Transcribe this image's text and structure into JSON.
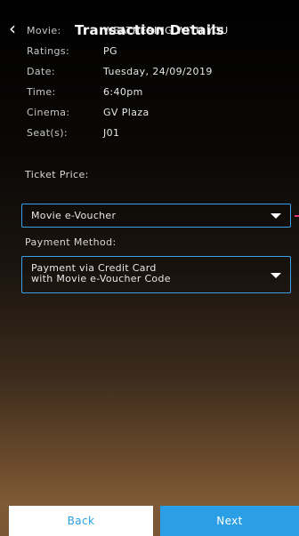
{
  "header": {
    "back_icon": "chevron-left-icon",
    "back_glyph": "‹",
    "title": "Transaction Details"
  },
  "details": [
    {
      "label": "Movie:",
      "value": "WEATHERING WITH YOU"
    },
    {
      "label": "Ratings:",
      "value": "PG"
    },
    {
      "label": "Date:",
      "value": "Tuesday, 24/09/2019"
    },
    {
      "label": "Time:",
      "value": "6:40pm"
    },
    {
      "label": "Cinema:",
      "value": "GV Plaza"
    },
    {
      "label": "Seat(s):",
      "value": "J01"
    }
  ],
  "ticket_price": {
    "label": "Ticket Price:",
    "selected": "Movie e-Voucher"
  },
  "payment_method": {
    "label": "Payment Method:",
    "selected": "Payment via Credit Card\nwith Movie e-Voucher Code"
  },
  "footer": {
    "back_label": "Back",
    "next_label": "Next"
  },
  "colors": {
    "accent": "#2a9fe6",
    "field_border": "#3aa0e8",
    "side_marker": "#e2347a"
  }
}
